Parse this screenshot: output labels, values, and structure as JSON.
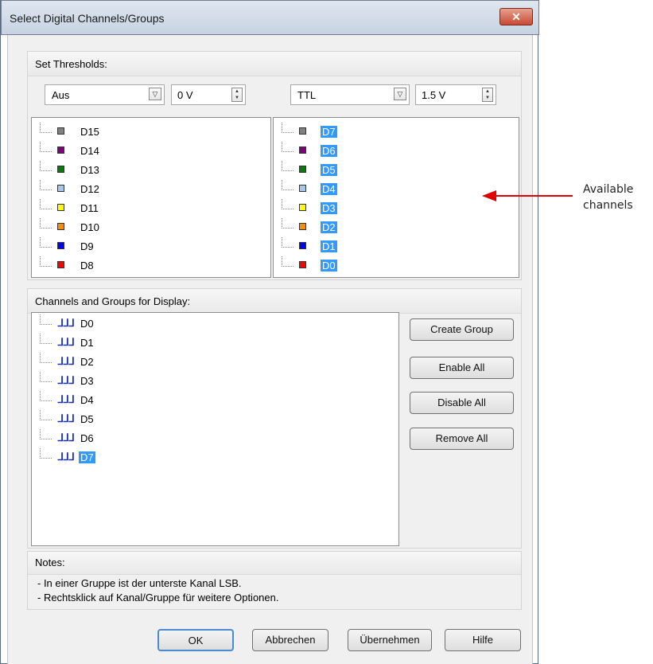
{
  "window": {
    "title": "Select Digital Channels/Groups",
    "close_glyph": "✕"
  },
  "thresholds": {
    "title": "Set Thresholds:",
    "left": {
      "logic": "Aus",
      "voltage": "0 V"
    },
    "right": {
      "logic": "TTL",
      "voltage": "1.5 V"
    }
  },
  "available_left": [
    {
      "label": "D15",
      "color": "#808080"
    },
    {
      "label": "D14",
      "color": "#800080"
    },
    {
      "label": "D13",
      "color": "#008000"
    },
    {
      "label": "D12",
      "color": "#a6c8ef"
    },
    {
      "label": "D11",
      "color": "#ffff00"
    },
    {
      "label": "D10",
      "color": "#ff8c00"
    },
    {
      "label": "D9",
      "color": "#0000ff"
    },
    {
      "label": "D8",
      "color": "#ff0000"
    }
  ],
  "available_right": [
    {
      "label": "D7",
      "color": "#808080"
    },
    {
      "label": "D6",
      "color": "#800080"
    },
    {
      "label": "D5",
      "color": "#008000"
    },
    {
      "label": "D4",
      "color": "#a6c8ef"
    },
    {
      "label": "D3",
      "color": "#ffff00"
    },
    {
      "label": "D2",
      "color": "#ff8c00"
    },
    {
      "label": "D1",
      "color": "#0000ff"
    },
    {
      "label": "D0",
      "color": "#ff0000"
    }
  ],
  "display": {
    "title": "Channels and Groups for Display:",
    "wave_glyph": "ᒧᒧᒧ",
    "items": [
      "D0",
      "D1",
      "D2",
      "D3",
      "D4",
      "D5",
      "D6",
      "D7"
    ],
    "selected_index": 7,
    "buttons": {
      "create_group": "Create Group",
      "enable_all": "Enable All",
      "disable_all": "Disable All",
      "remove_all": "Remove All"
    }
  },
  "notes": {
    "title": "Notes:",
    "line1": "- In einer Gruppe ist der unterste Kanal LSB.",
    "line2": "- Rechtsklick auf Kanal/Gruppe für weitere Optionen."
  },
  "footer": {
    "ok": "OK",
    "cancel": "Abbrechen",
    "apply": "Übernehmen",
    "help": "Hilfe"
  },
  "annotation": {
    "line1": "Available",
    "line2": "channels",
    "arrow_color": "#e00000"
  }
}
